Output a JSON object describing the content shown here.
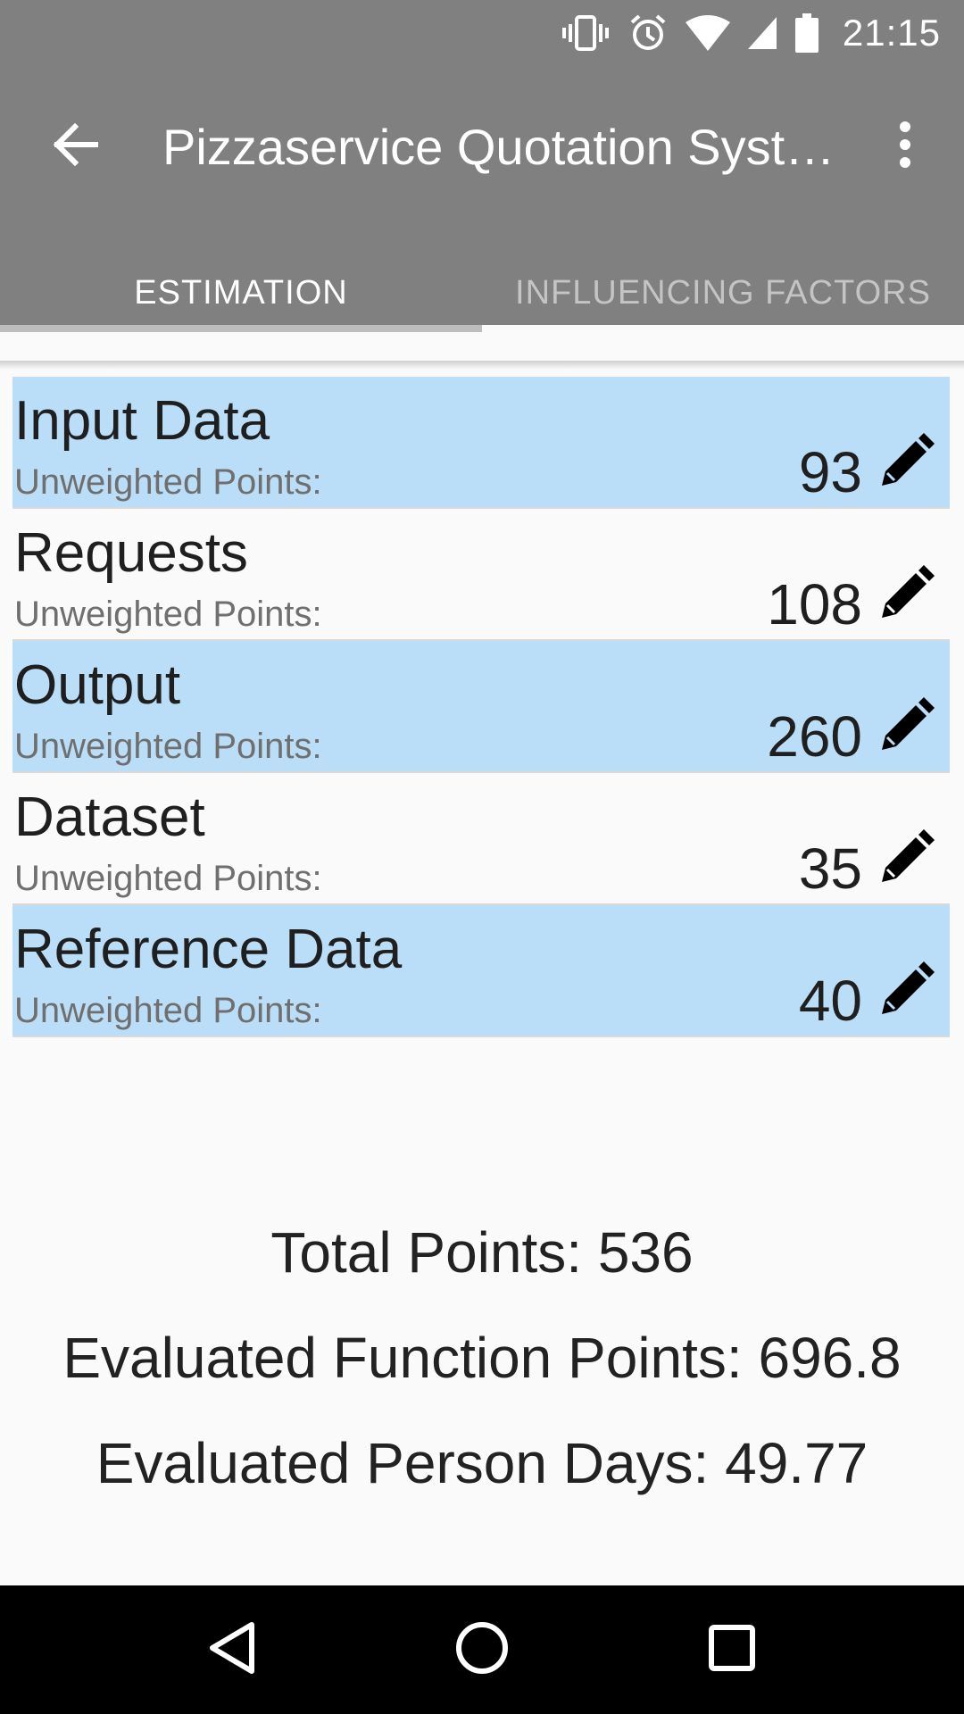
{
  "status_bar": {
    "time": "21:15",
    "icons": [
      "vibrate-icon",
      "alarm-icon",
      "wifi-icon",
      "signal-icon",
      "battery-icon"
    ]
  },
  "toolbar": {
    "title": "Pizzaservice Quotation System",
    "back_icon": "back-arrow-icon",
    "overflow_icon": "more-vert-icon"
  },
  "tabs": [
    {
      "label": "ESTIMATION",
      "active": true
    },
    {
      "label": "INFLUENCING FACTORS",
      "active": false
    }
  ],
  "items": [
    {
      "title": "Input Data",
      "subtitle": "Unweighted Points:",
      "value": "93",
      "highlight": true
    },
    {
      "title": "Requests",
      "subtitle": "Unweighted Points:",
      "value": "108",
      "highlight": false
    },
    {
      "title": "Output",
      "subtitle": "Unweighted Points:",
      "value": "260",
      "highlight": true
    },
    {
      "title": "Dataset",
      "subtitle": "Unweighted Points:",
      "value": "35",
      "highlight": false
    },
    {
      "title": "Reference Data",
      "subtitle": "Unweighted Points:",
      "value": "40",
      "highlight": true
    }
  ],
  "summary": {
    "total_points": "Total Points: 536",
    "function_points": "Evaluated Function Points: 696.8",
    "person_days": "Evaluated Person Days: 49.77"
  },
  "colors": {
    "app_bar": "#808080",
    "row_highlight": "#bbdef8",
    "background": "#fafafa"
  }
}
